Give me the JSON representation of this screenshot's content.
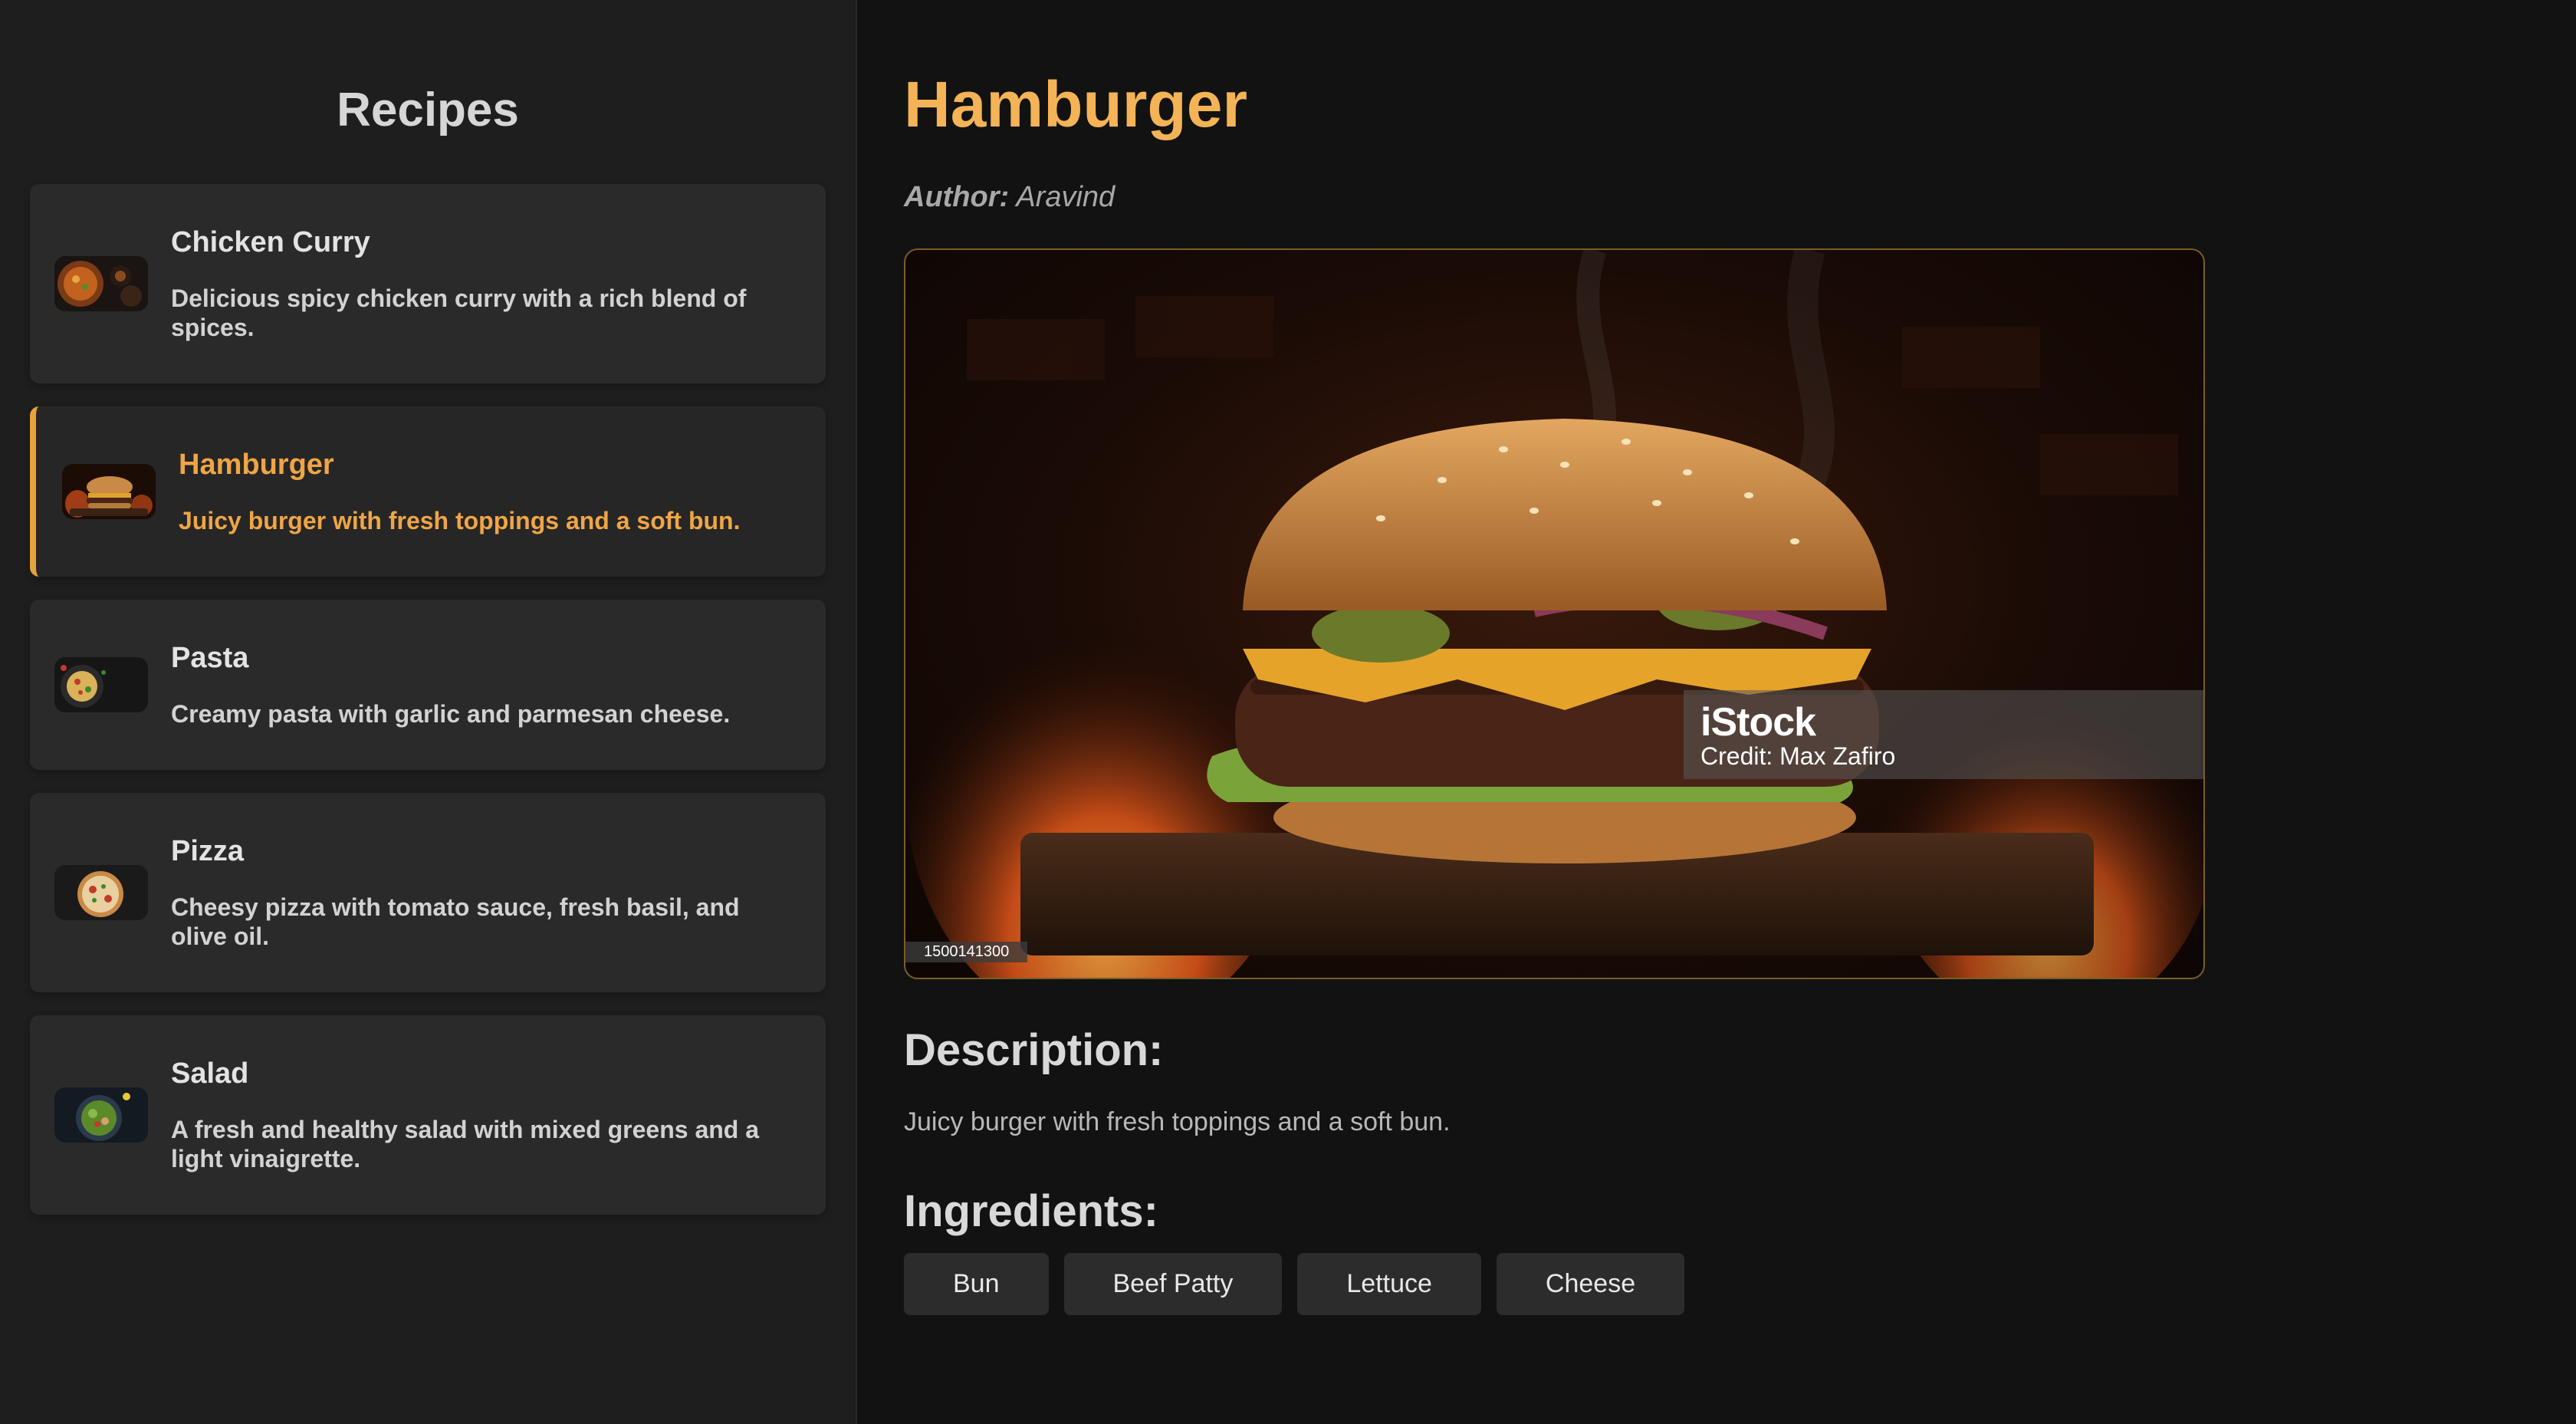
{
  "sidebar": {
    "title": "Recipes",
    "items": [
      {
        "name": "Chicken Curry",
        "description": "Delicious spicy chicken curry with a rich blend of spices.",
        "thumb": "curry-thumbnail",
        "active": false
      },
      {
        "name": "Hamburger",
        "description": "Juicy burger with fresh toppings and a soft bun.",
        "thumb": "burger-thumbnail",
        "active": true
      },
      {
        "name": "Pasta",
        "description": "Creamy pasta with garlic and parmesan cheese.",
        "thumb": "pasta-thumbnail",
        "active": false
      },
      {
        "name": "Pizza",
        "description": "Cheesy pizza with tomato sauce, fresh basil, and olive oil.",
        "thumb": "pizza-thumbnail",
        "active": false
      },
      {
        "name": "Salad",
        "description": "A fresh and healthy salad with mixed greens and a light vinaigrette.",
        "thumb": "salad-thumbnail",
        "active": false
      }
    ]
  },
  "detail": {
    "title": "Hamburger",
    "author_label": "Author:",
    "author_name": "Aravind",
    "image": {
      "watermark_brand": "iStock",
      "watermark_credit": "Credit: Max Zafiro",
      "image_id": "1500141300"
    },
    "description_heading": "Description:",
    "description": "Juicy burger with fresh toppings and a soft bun.",
    "ingredients_heading": "Ingredients:",
    "ingredients": [
      "Bun",
      "Beef Patty",
      "Lettuce",
      "Cheese"
    ]
  },
  "colors": {
    "accent": "#f3b356",
    "active_text": "#f0a545",
    "sidebar_bg": "#1e1e1e",
    "main_bg": "#121212",
    "card_bg": "#2a2a2a"
  }
}
